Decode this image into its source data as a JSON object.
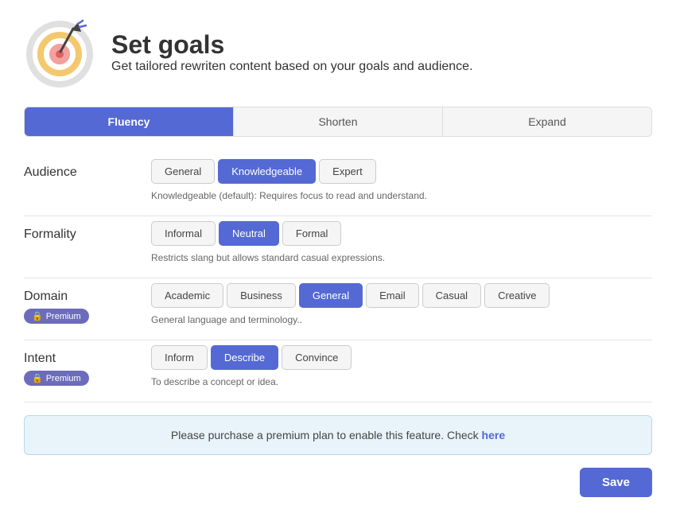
{
  "header": {
    "title": "Set goals",
    "subtitle": "Get tailored rewriten content based on your goals and audience."
  },
  "tabs": [
    {
      "id": "fluency",
      "label": "Fluency",
      "active": true
    },
    {
      "id": "shorten",
      "label": "Shorten",
      "active": false
    },
    {
      "id": "expand",
      "label": "Expand",
      "active": false
    }
  ],
  "sections": {
    "audience": {
      "label": "Audience",
      "options": [
        "General",
        "Knowledgeable",
        "Expert"
      ],
      "selected": "Knowledgeable",
      "hint": "Knowledgeable (default): Requires focus to read and understand."
    },
    "formality": {
      "label": "Formality",
      "options": [
        "Informal",
        "Neutral",
        "Formal"
      ],
      "selected": "Neutral",
      "hint": "Restricts slang but allows standard casual expressions."
    },
    "domain": {
      "label": "Domain",
      "premium": true,
      "premium_label": "Premium",
      "options": [
        "Academic",
        "Business",
        "General",
        "Email",
        "Casual",
        "Creative"
      ],
      "selected": "General",
      "hint": "General language and terminology.."
    },
    "intent": {
      "label": "Intent",
      "premium": true,
      "premium_label": "Premium",
      "options": [
        "Inform",
        "Describe",
        "Convince"
      ],
      "selected": "Describe",
      "hint": "To describe a concept or idea."
    }
  },
  "premium_notice": {
    "text": "Please purchase a premium plan to enable this feature. Check",
    "link_text": "here"
  },
  "save_button": "Save",
  "icons": {
    "lock": "🔒"
  }
}
